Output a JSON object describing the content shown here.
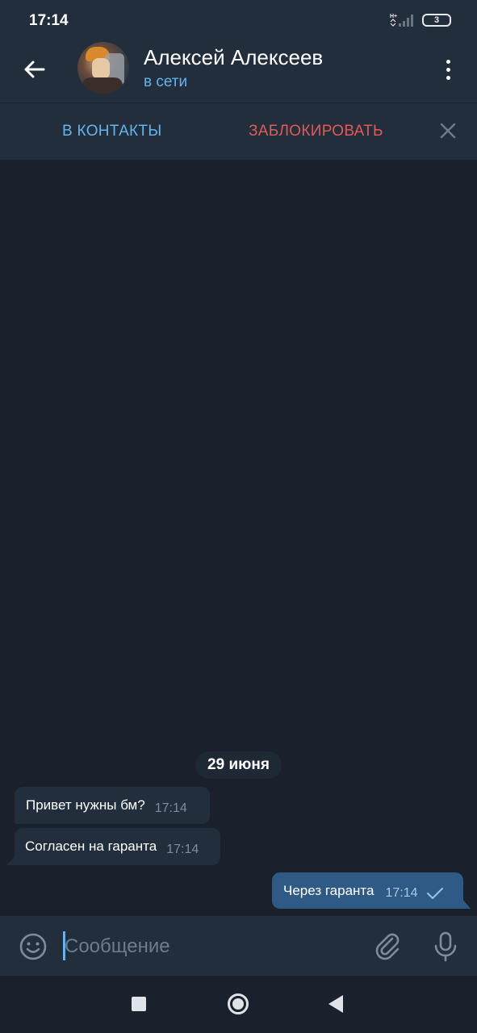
{
  "status_bar": {
    "time": "17:14",
    "network": "H+",
    "battery": "3"
  },
  "header": {
    "title": "Алексей Алексеев",
    "subtitle": "в сети"
  },
  "action_bar": {
    "add_contact_label": "В КОНТАКТЫ",
    "block_label": "ЗАБЛОКИРОВАТЬ"
  },
  "chat": {
    "date_label": "29 июня",
    "messages": [
      {
        "direction": "incoming",
        "text": "Привет нужны бм?",
        "time": "17:14"
      },
      {
        "direction": "incoming",
        "text": "Согласен на гаранта",
        "time": "17:14"
      },
      {
        "direction": "outgoing",
        "text": "Через гаранта",
        "time": "17:14",
        "status": "sent"
      }
    ]
  },
  "input_bar": {
    "placeholder": "Сообщение"
  },
  "colors": {
    "background": "#1a212c",
    "panel": "#232e3c",
    "accent": "#62b4f0",
    "danger": "#e05a56",
    "outgoing_bubble": "#2f5a86"
  }
}
